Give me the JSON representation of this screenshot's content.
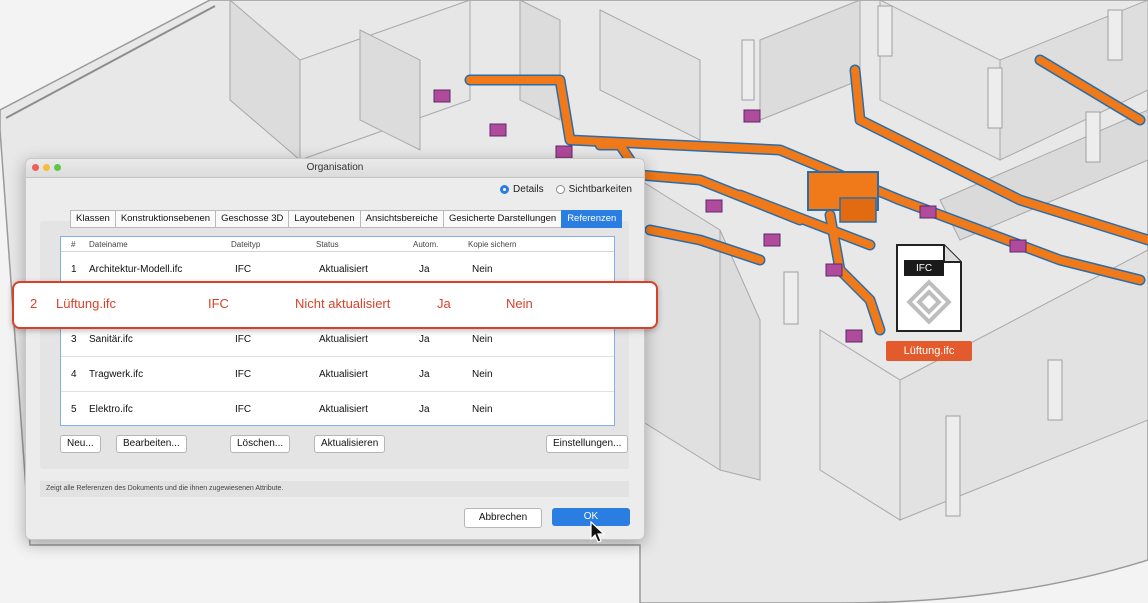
{
  "dialog": {
    "title": "Organisation",
    "radios": [
      {
        "label": "Details",
        "selected": true
      },
      {
        "label": "Sichtbarkeiten",
        "selected": false
      }
    ],
    "tabs": [
      {
        "label": "Klassen",
        "active": false
      },
      {
        "label": "Konstruktionsebenen",
        "active": false
      },
      {
        "label": "Geschosse 3D",
        "active": false
      },
      {
        "label": "Layoutebenen",
        "active": false
      },
      {
        "label": "Ansichtsbereiche",
        "active": false
      },
      {
        "label": "Gesicherte Darstellungen",
        "active": false
      },
      {
        "label": "Referenzen",
        "active": true
      }
    ],
    "columns": [
      "#",
      "Dateiname",
      "Dateityp",
      "Status",
      "Autom.",
      "Kopie sichern"
    ],
    "rows": [
      {
        "num": "1",
        "name": "Architektur-Modell.ifc",
        "type": "IFC",
        "status": "Aktualisiert",
        "auto": "Ja",
        "copy": "Nein"
      },
      {
        "num": "3",
        "name": "Sanitär.ifc",
        "type": "IFC",
        "status": "Aktualisiert",
        "auto": "Ja",
        "copy": "Nein"
      },
      {
        "num": "4",
        "name": "Tragwerk.ifc",
        "type": "IFC",
        "status": "Aktualisiert",
        "auto": "Ja",
        "copy": "Nein"
      },
      {
        "num": "5",
        "name": "Elektro.ifc",
        "type": "IFC",
        "status": "Aktualisiert",
        "auto": "Ja",
        "copy": "Nein"
      }
    ],
    "buttons": {
      "new": "Neu...",
      "edit": "Bearbeiten...",
      "delete": "Löschen...",
      "update": "Aktualisieren",
      "settings": "Einstellungen..."
    },
    "status_text": "Zeigt alle Referenzen des Dokuments und die ihnen zugewiesenen Attribute.",
    "cancel_label": "Abbrechen",
    "ok_label": "OK"
  },
  "highlight_row": {
    "num": "2",
    "name": "Lüftung.ifc",
    "type": "IFC",
    "status": "Nicht aktualisiert",
    "auto": "Ja",
    "copy": "Nein"
  },
  "ifc_icon": {
    "label": "IFC",
    "file_label": "Lüftung.ifc"
  },
  "colors": {
    "accent": "#2a7de1",
    "highlight": "#d7412a",
    "duct": "#f07a1a",
    "duct_outline": "#2c6da8",
    "diffuser": "#b04a9a"
  }
}
